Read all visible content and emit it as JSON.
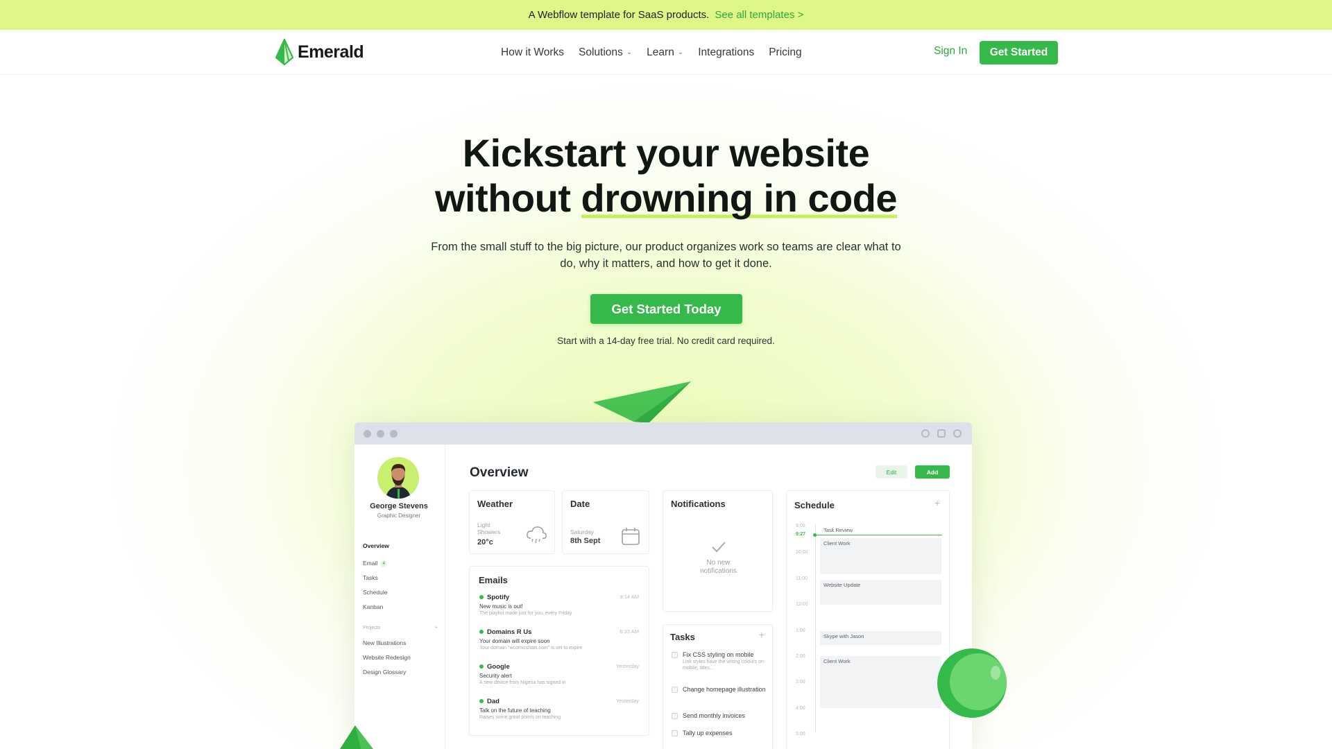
{
  "banner": {
    "text": "A Webflow template for SaaS products.",
    "link": "See all templates >"
  },
  "nav": {
    "logo": "Emerald",
    "items": [
      {
        "label": "How it Works",
        "dropdown": false
      },
      {
        "label": "Solutions",
        "dropdown": true
      },
      {
        "label": "Learn",
        "dropdown": true
      },
      {
        "label": "Integrations",
        "dropdown": false
      },
      {
        "label": "Pricing",
        "dropdown": false
      }
    ],
    "signin": "Sign In",
    "cta": "Get Started"
  },
  "hero": {
    "title_line1": "Kickstart your website",
    "title_line2_plain": "without ",
    "title_line2_underlined": "drowning in code",
    "subtitle": "From the small stuff to the big picture, our product organizes work so teams are clear what to do, why it matters, and how to get it done.",
    "cta": "Get Started Today",
    "note": "Start with a 14-day free trial. No credit card required."
  },
  "app": {
    "user": {
      "name": "George Stevens",
      "role": "Graphic Designer"
    },
    "sidebar": {
      "items": [
        "Overview",
        "Email",
        "Tasks",
        "Schedule",
        "Kanban"
      ],
      "email_badge": "4",
      "projects_label": "Projects",
      "projects_add": "+",
      "projects": [
        "New Illustrations",
        "Website Redesign",
        "Design Glossary"
      ]
    },
    "title": "Overview",
    "edit": "Edit",
    "add": "Add",
    "weather": {
      "title": "Weather",
      "condition_line1": "Light",
      "condition_line2": "Showers",
      "temp": "20°c"
    },
    "date": {
      "title": "Date",
      "day": "Saturday",
      "date": "8th Sept"
    },
    "notifications": {
      "title": "Notifications",
      "empty_line1": "No new",
      "empty_line2": "notifications"
    },
    "emails": {
      "title": "Emails",
      "items": [
        {
          "from": "Spotify",
          "time": "9:14 AM",
          "subject": "New music is out!",
          "preview": "The playlist made just for you, every Friday"
        },
        {
          "from": "Domains R Us",
          "time": "6:33 AM",
          "subject": "Your domain will expire soon",
          "preview": "Your domain \"wcomicshats.com\" is set to expire"
        },
        {
          "from": "Google",
          "time": "Yesterday",
          "subject": "Security alert",
          "preview": "A new device from Nigeria has signed in"
        },
        {
          "from": "Dad",
          "time": "Yesterday",
          "subject": "Talk on the future of teaching",
          "preview": "Raises some great points on teaching"
        }
      ]
    },
    "tasks": {
      "title": "Tasks",
      "add": "+",
      "items": [
        {
          "title": "Fix CSS styling on mobile",
          "sub": "Link styles have the wrong colours on mobile, titles..."
        },
        {
          "title": "Change homepage illustration",
          "sub": ""
        },
        {
          "title": "Send monthly invoices",
          "sub": ""
        },
        {
          "title": "Tally up expenses",
          "sub": ""
        }
      ]
    },
    "schedule": {
      "title": "Schedule",
      "add": "+",
      "now": "9:27",
      "hours": [
        "9:00",
        "10:00",
        "11:00",
        "12:00",
        "1:00",
        "2:00",
        "3:00",
        "4:00",
        "5:00"
      ],
      "events": [
        "Task Review",
        "Client Work",
        "Website Update",
        "Skype with Jason",
        "Client Work"
      ]
    }
  },
  "colors": {
    "accent": "#34b94a",
    "banner": "#def788",
    "text": "#141a17"
  }
}
